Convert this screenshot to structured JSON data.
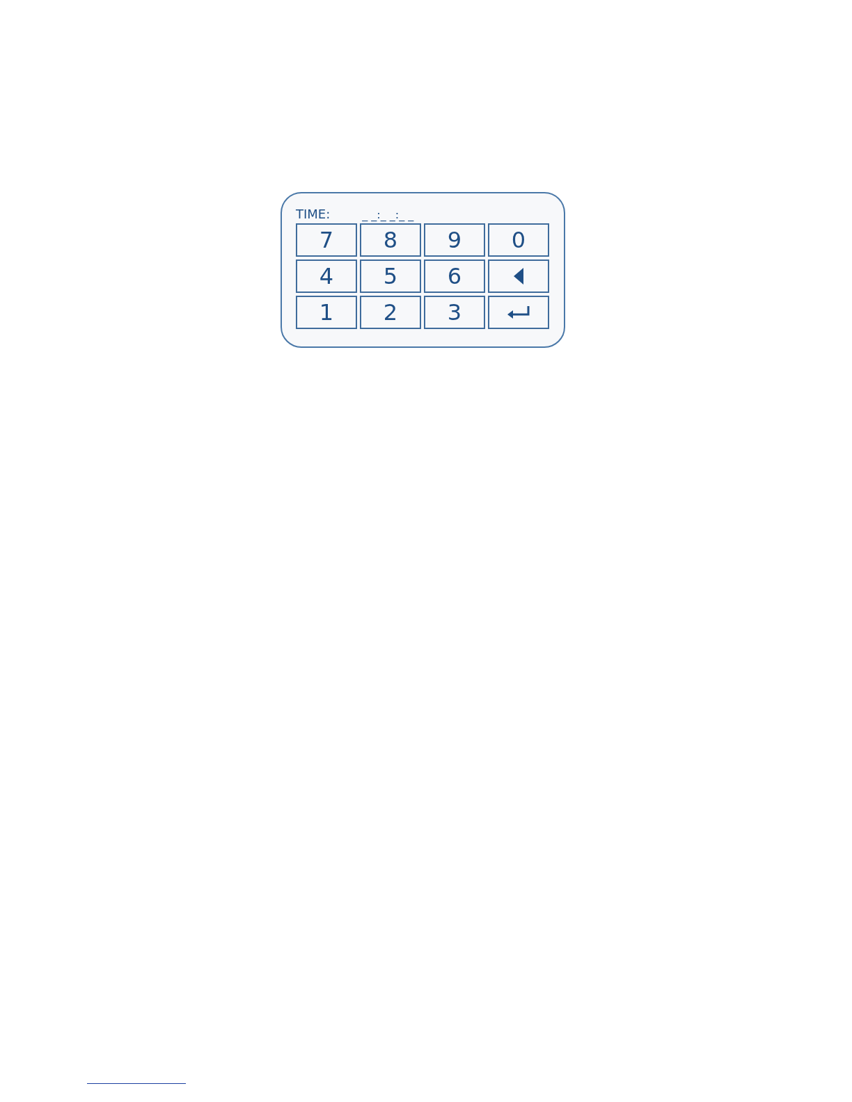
{
  "keypad": {
    "time_label": "TIME:",
    "time_value": "_ _:_ _:_ _",
    "keys": [
      {
        "kind": "digit",
        "label": "7"
      },
      {
        "kind": "digit",
        "label": "8"
      },
      {
        "kind": "digit",
        "label": "9"
      },
      {
        "kind": "digit",
        "label": "0"
      },
      {
        "kind": "digit",
        "label": "4"
      },
      {
        "kind": "digit",
        "label": "5"
      },
      {
        "kind": "digit",
        "label": "6"
      },
      {
        "kind": "backspace"
      },
      {
        "kind": "digit",
        "label": "1"
      },
      {
        "kind": "digit",
        "label": "2"
      },
      {
        "kind": "digit",
        "label": "3"
      },
      {
        "kind": "enter"
      }
    ]
  }
}
